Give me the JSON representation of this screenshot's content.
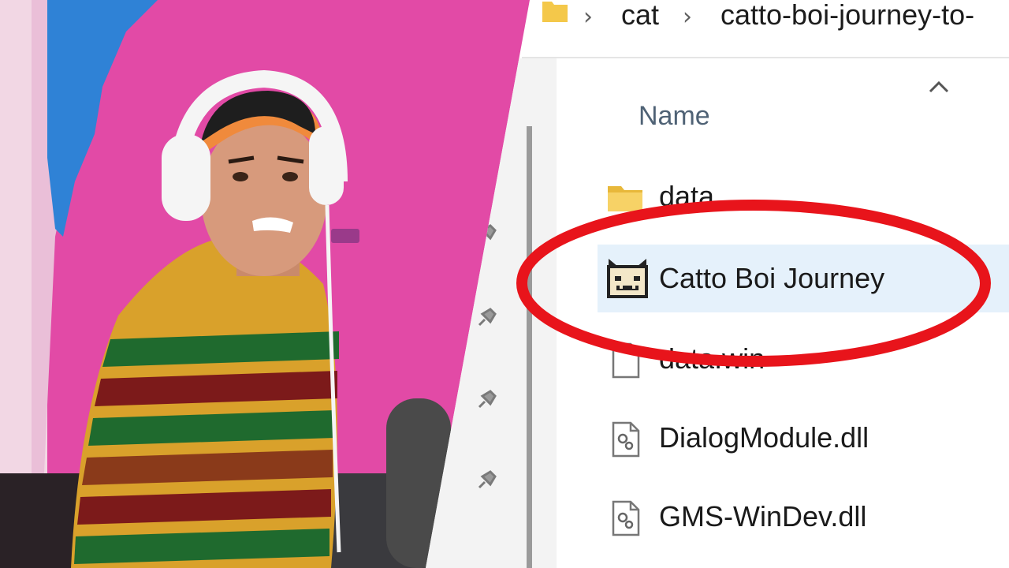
{
  "address_bar": {
    "crumbs": [
      "cat",
      "catto-boi-journey-to-"
    ]
  },
  "file_list": {
    "column_header": "Name",
    "items": [
      {
        "name": "data",
        "type": "folder"
      },
      {
        "name": "Catto Boi Journey",
        "type": "app",
        "selected": true
      },
      {
        "name": "data.win",
        "type": "file"
      },
      {
        "name": "DialogModule.dll",
        "type": "dll"
      },
      {
        "name": "GMS-WinDev.dll",
        "type": "dll"
      }
    ]
  },
  "icons": [
    "folder-icon",
    "cat-app-icon",
    "file-icon",
    "dll-file-icon",
    "pin-icon",
    "chevron-right-icon",
    "sort-caret-icon"
  ],
  "colors": {
    "highlight_circle": "#e8141b",
    "selection": "#e5f1fb",
    "folder": "#f4c84a"
  }
}
